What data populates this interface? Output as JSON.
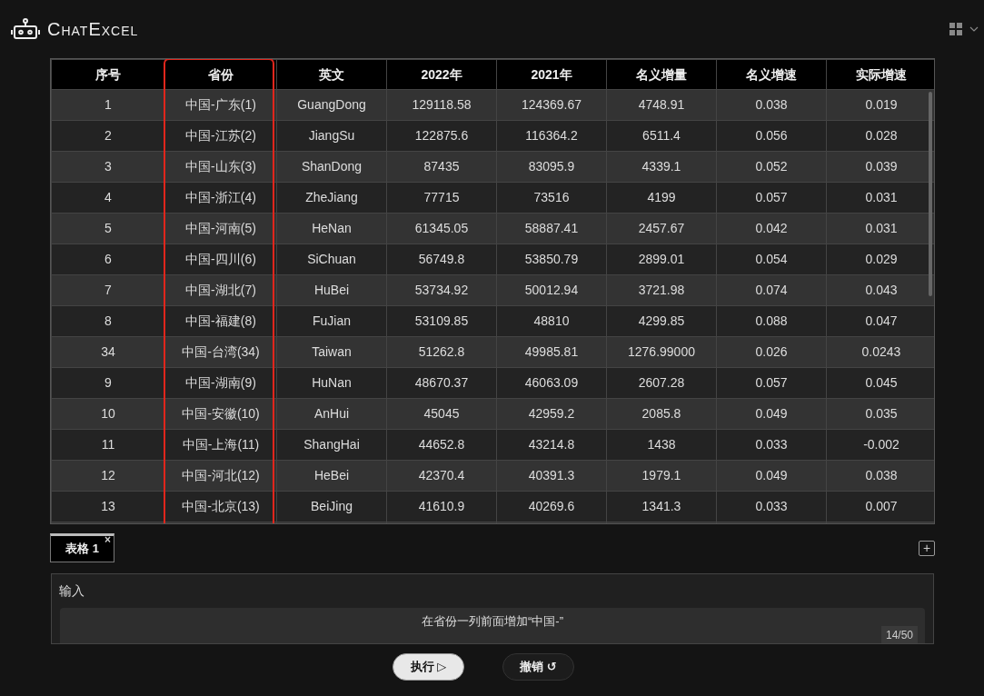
{
  "app": {
    "title": "ChatExcel"
  },
  "table": {
    "columns": [
      {
        "label": "序号",
        "highlighted": false
      },
      {
        "label": "省份",
        "highlighted": true
      },
      {
        "label": "英文",
        "highlighted": false
      },
      {
        "label": "2022年",
        "highlighted": false
      },
      {
        "label": "2021年",
        "highlighted": false
      },
      {
        "label": "名义增量",
        "highlighted": false
      },
      {
        "label": "名义增速",
        "highlighted": false
      },
      {
        "label": "实际增速",
        "highlighted": false
      }
    ],
    "rows": [
      [
        "1",
        "中国-广东(1)",
        "GuangDong",
        "129118.58",
        "124369.67",
        "4748.91",
        "0.038",
        "0.019"
      ],
      [
        "2",
        "中国-江苏(2)",
        "JiangSu",
        "122875.6",
        "116364.2",
        "6511.4",
        "0.056",
        "0.028"
      ],
      [
        "3",
        "中国-山东(3)",
        "ShanDong",
        "87435",
        "83095.9",
        "4339.1",
        "0.052",
        "0.039"
      ],
      [
        "4",
        "中国-浙江(4)",
        "ZheJiang",
        "77715",
        "73516",
        "4199",
        "0.057",
        "0.031"
      ],
      [
        "5",
        "中国-河南(5)",
        "HeNan",
        "61345.05",
        "58887.41",
        "2457.67",
        "0.042",
        "0.031"
      ],
      [
        "6",
        "中国-四川(6)",
        "SiChuan",
        "56749.8",
        "53850.79",
        "2899.01",
        "0.054",
        "0.029"
      ],
      [
        "7",
        "中国-湖北(7)",
        "HuBei",
        "53734.92",
        "50012.94",
        "3721.98",
        "0.074",
        "0.043"
      ],
      [
        "8",
        "中国-福建(8)",
        "FuJian",
        "53109.85",
        "48810",
        "4299.85",
        "0.088",
        "0.047"
      ],
      [
        "34",
        "中国-台湾(34)",
        "Taiwan",
        "51262.8",
        "49985.81",
        "1276.99000",
        "0.026",
        "0.0243"
      ],
      [
        "9",
        "中国-湖南(9)",
        "HuNan",
        "48670.37",
        "46063.09",
        "2607.28",
        "0.057",
        "0.045"
      ],
      [
        "10",
        "中国-安徽(10)",
        "AnHui",
        "45045",
        "42959.2",
        "2085.8",
        "0.049",
        "0.035"
      ],
      [
        "11",
        "中国-上海(11)",
        "ShangHai",
        "44652.8",
        "43214.8",
        "1438",
        "0.033",
        "-0.002"
      ],
      [
        "12",
        "中国-河北(12)",
        "HeBei",
        "42370.4",
        "40391.3",
        "1979.1",
        "0.049",
        "0.038"
      ],
      [
        "13",
        "中国-北京(13)",
        "BeiJing",
        "41610.9",
        "40269.6",
        "1341.3",
        "0.033",
        "0.007"
      ]
    ]
  },
  "sheet_tabs": [
    {
      "label": "表格 1",
      "selected": true,
      "close": "×"
    }
  ],
  "add_sheet": "+",
  "input": {
    "label": "输入",
    "value": "在省份一列前面增加“中国-”",
    "counter": "14/50"
  },
  "buttons": [
    {
      "label": "执行",
      "icon": "▷",
      "kind": "primary"
    },
    {
      "label": "撤销",
      "icon": "↺",
      "kind": "secondary"
    }
  ]
}
